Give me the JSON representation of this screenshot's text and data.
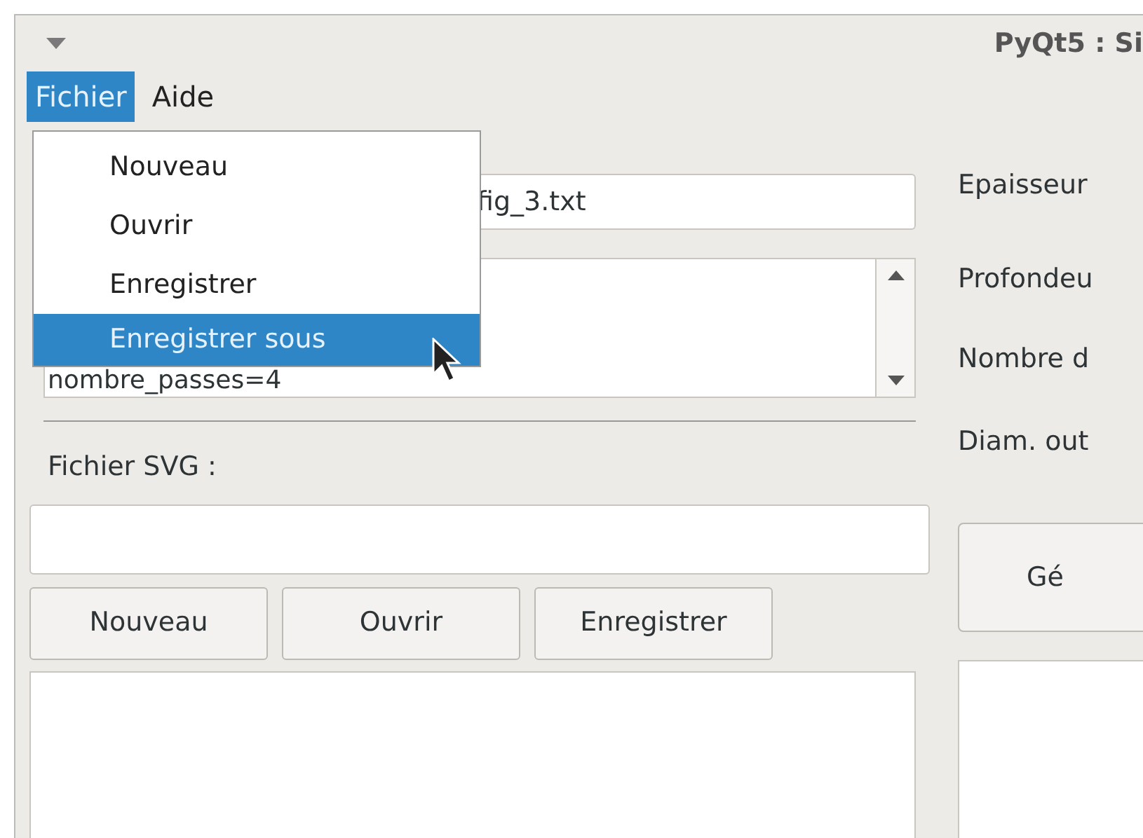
{
  "window": {
    "title": "PyQt5 : Si"
  },
  "menubar": [
    {
      "label": "Fichier",
      "selected": true
    },
    {
      "label": "Aide",
      "selected": false
    }
  ],
  "menu": {
    "items": [
      {
        "label": "Nouveau",
        "selected": false
      },
      {
        "label": "Ouvrir",
        "selected": false
      },
      {
        "label": "Enregistrer",
        "selected": false
      },
      {
        "label": "Enregistrer sous",
        "selected": true
      }
    ]
  },
  "config_file": {
    "value": "fig_3.txt"
  },
  "config_text": {
    "lines": [
      "nombre_passes=4"
    ]
  },
  "svg_label": "Fichier SVG :",
  "svg_buttons": [
    "Nouveau",
    "Ouvrir",
    "Enregistrer"
  ],
  "right_labels": [
    "Epaisseur",
    "Profondeu",
    "Nombre d",
    "Diam. out"
  ],
  "generate_button": "Gé"
}
